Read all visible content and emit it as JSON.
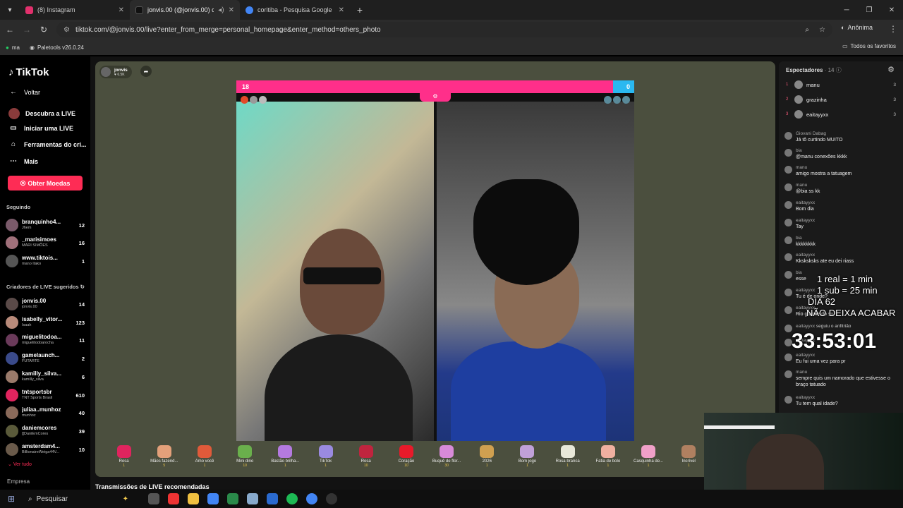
{
  "browser": {
    "tabs": [
      {
        "title": "(8) Instagram",
        "color": "#e1306c",
        "active": false
      },
      {
        "title": "jonvis.00 (@jonvis.00) com",
        "color": "#000000",
        "active": true
      },
      {
        "title": "coritiba - Pesquisa Google",
        "color": "#4285f4",
        "active": false
      }
    ],
    "url": "tiktok.com/@jonvis.00/live?enter_from_merge=personal_homepage&enter_method=others_photo",
    "profile_label": "Anônima",
    "bookmarks": [
      {
        "label": "ma"
      },
      {
        "label": "Paletools v26.0.24"
      }
    ],
    "all_bookmarks": "Todos os favoritos"
  },
  "sidebar": {
    "logo": "TikTok",
    "back": "Voltar",
    "nav": [
      {
        "label": "Descubra a LIVE",
        "icon": "live-discover-icon"
      },
      {
        "label": "Iniciar uma LIVE",
        "icon": "camera-icon"
      },
      {
        "label": "Ferramentas do cri...",
        "icon": "home-tools-icon"
      },
      {
        "label": "Mais",
        "icon": "more-dots-icon"
      }
    ],
    "coins_button": "Obter Moedas",
    "following_header": "Seguindo",
    "following": [
      {
        "name": "branquinho4...",
        "sub": "Jhem",
        "count": "12"
      },
      {
        "name": "_marisimoes",
        "sub": "MARI SIMÕES",
        "count": "16"
      },
      {
        "name": "www.tiktois...",
        "sub": "mano Itako",
        "count": "1"
      }
    ],
    "suggested_header": "Criadores de LIVE sugeridos",
    "suggested": [
      {
        "name": "jonvis.00",
        "sub": "jonvis.00",
        "count": "14"
      },
      {
        "name": "isabelly_vitor...",
        "sub": "Isaah",
        "count": "123"
      },
      {
        "name": "miguelitodoa...",
        "sub": "miguelitodoarocha",
        "count": "11"
      },
      {
        "name": "gamelaunch...",
        "sub": "FUTARTE",
        "count": "2"
      },
      {
        "name": "kamilly_silva...",
        "sub": "kamilly_silva",
        "count": "6"
      },
      {
        "name": "tntsportsbr",
        "sub": "TNT Sports Brasil",
        "count": "610"
      },
      {
        "name": "juliaa..munhoz",
        "sub": "munhoz",
        "count": "40"
      },
      {
        "name": "daniemcores",
        "sub": "[[DaniEmCores",
        "count": "39"
      },
      {
        "name": "amsterdam4...",
        "sub": "BillionaireWeiga44V...",
        "count": "10"
      }
    ],
    "see_all": "Ver tudo",
    "company": "Empresa"
  },
  "player": {
    "host_name": "jonvis",
    "host_likes": "6.5K",
    "score_left": "18",
    "score_right": "0",
    "gifts": [
      {
        "name": "Rosa",
        "price": "1"
      },
      {
        "name": "Mãos fazend...",
        "price": "5"
      },
      {
        "name": "Amo você",
        "price": "1"
      },
      {
        "name": "Mini dino",
        "price": "10"
      },
      {
        "name": "Bastão brilha...",
        "price": "1"
      },
      {
        "name": "TikTok",
        "price": "1"
      },
      {
        "name": "Rosa",
        "price": "10"
      },
      {
        "name": "Coração",
        "price": "10"
      },
      {
        "name": "Buquê de flor...",
        "price": "30"
      },
      {
        "name": "2026",
        "price": "1"
      },
      {
        "name": "Bom jogo",
        "price": "1"
      },
      {
        "name": "Rosa branca",
        "price": "1"
      },
      {
        "name": "Fatia de bolo",
        "price": "1"
      },
      {
        "name": "Casquinha de...",
        "price": "1"
      },
      {
        "name": "Incrível",
        "price": "1"
      }
    ],
    "recommended": "Transmissões de LIVE recomendadas"
  },
  "chat": {
    "header": "Espectadores",
    "viewer_count": "· 14",
    "top_viewers": [
      {
        "rank": "1",
        "name": "manu",
        "n": "3"
      },
      {
        "rank": "2",
        "name": "grazinha",
        "n": "3"
      },
      {
        "rank": "3",
        "name": "eaitayyxx",
        "n": "3"
      }
    ],
    "messages": [
      {
        "user": "Giovani Dabag",
        "text": "Já tô curtindo MUITO"
      },
      {
        "user": "bia",
        "text": "@manu conexões kkkk"
      },
      {
        "user": "manu",
        "text": "amigo mostra a tatuagem"
      },
      {
        "user": "manu",
        "text": "@bia ss kk"
      },
      {
        "user": "eaitayyxx",
        "text": "Bom dia"
      },
      {
        "user": "eaitayyxx",
        "text": "Tay"
      },
      {
        "user": "bia",
        "text": "kkkkkkkk"
      },
      {
        "user": "eaitayyxx",
        "text": "Kksksksks ate eu dei riass"
      },
      {
        "user": "bia",
        "text": "esse"
      },
      {
        "user": "eaitayyxx",
        "text": "Tu é de onde?"
      },
      {
        "user": "eaitayyxx",
        "text": "Rio grande do sul"
      },
      {
        "user": "eaitayyxx",
        "text": "seguiu o anfitrião"
      },
      {
        "user": "eaitayyxx",
        "text": ""
      },
      {
        "user": "eaitayyxx",
        "text": "Eu fui uma vez para pr"
      },
      {
        "user": "manu",
        "text": "sempre quis um namorado que estivesse o braço tatuado"
      },
      {
        "user": "eaitayyxx",
        "text": "Tu tem qual idade?"
      }
    ]
  },
  "overlay": {
    "line1": "1 real = 1 min",
    "line2": "1 sub = 25 min",
    "line3": "DIA 62",
    "line4": "NÃO DEIXA ACABAR",
    "timer": "33:53:01"
  },
  "taskbar": {
    "search": "Pesquisar"
  }
}
